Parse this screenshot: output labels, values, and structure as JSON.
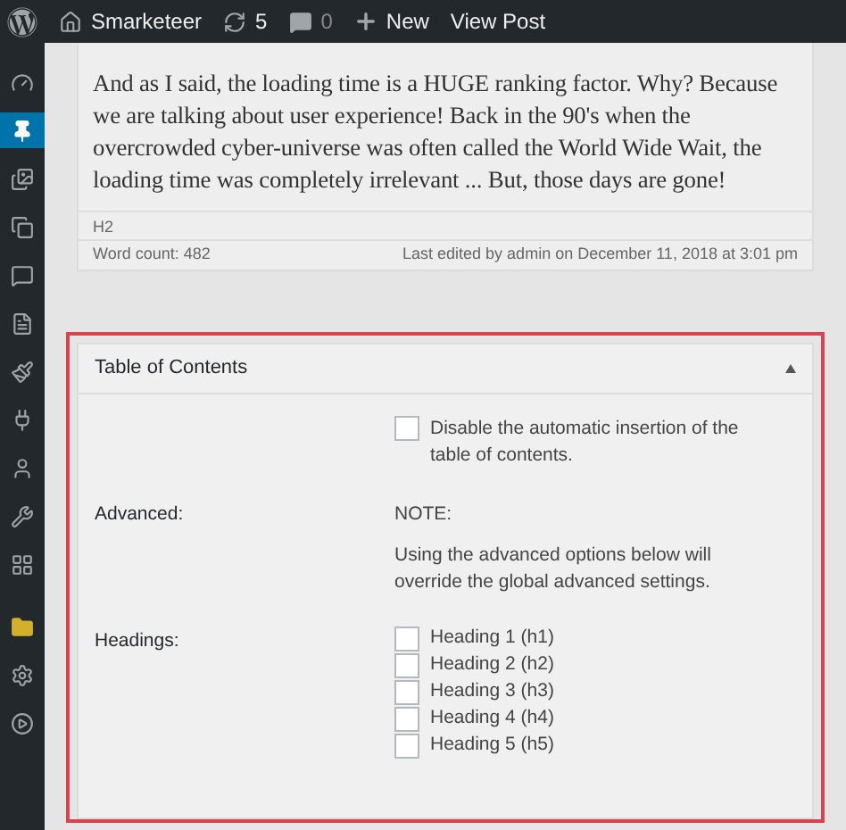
{
  "admin_bar": {
    "site": "Smarketeer",
    "updates": "5",
    "comments": "0",
    "new": "New",
    "view_post": "View Post"
  },
  "sidebar": {
    "items": [
      {
        "selected": false
      },
      {
        "selected": true
      },
      {
        "selected": false
      },
      {
        "selected": false
      },
      {
        "selected": false
      },
      {
        "selected": false
      },
      {
        "selected": false
      },
      {
        "selected": false
      },
      {
        "selected": false
      },
      {
        "selected": false
      },
      {
        "selected": false
      },
      {
        "selected": false
      },
      {
        "selected": false
      },
      {
        "selected": false
      }
    ]
  },
  "editor": {
    "paragraph": "And as I said, the loading time is a HUGE ranking factor. Why? Because we are talking about user experience! Back in the 90's when the overcrowded cyber-universe was often called the World Wide Wait, the loading time was completely irrelevant ... But, those days are gone!",
    "block_path": "H2",
    "word_count": "Word count: 482",
    "last_edited": "Last edited by admin on December 11, 2018 at 3:01 pm"
  },
  "toc_panel": {
    "title": "Table of Contents",
    "expanded": true,
    "disable_option": {
      "label": "Disable the automatic insertion of the table of contents.",
      "checked": false
    },
    "advanced": {
      "label": "Advanced:",
      "note_title": "NOTE:",
      "note": "Using the advanced options below will override the global advanced settings."
    },
    "headings": {
      "label": "Headings:",
      "options": [
        {
          "label": "Heading 1 (h1)",
          "checked": false
        },
        {
          "label": "Heading 2 (h2)",
          "checked": false
        },
        {
          "label": "Heading 3 (h3)",
          "checked": false
        },
        {
          "label": "Heading 4 (h4)",
          "checked": false
        },
        {
          "label": "Heading 5 (h5)",
          "checked": false
        }
      ]
    }
  }
}
